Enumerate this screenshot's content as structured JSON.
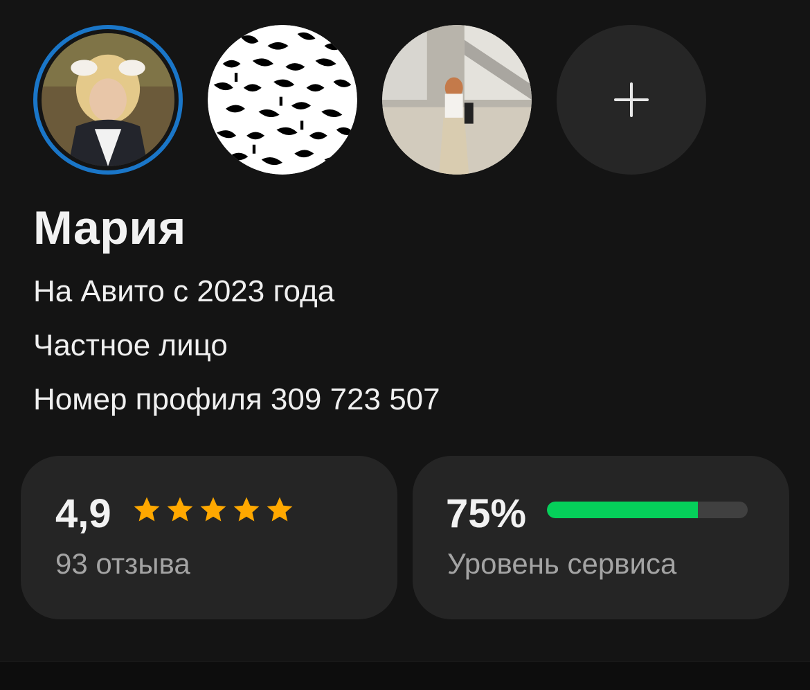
{
  "profile": {
    "name": "Мария",
    "since": "На Авито с 2023 года",
    "type": "Частное лицо",
    "profile_number": "Номер профиля 309 723 507"
  },
  "stories": [
    {
      "label": "story-photo-1",
      "active": true
    },
    {
      "label": "story-pattern-2",
      "active": false
    },
    {
      "label": "story-photo-3",
      "active": false
    }
  ],
  "rating": {
    "value": "4,9",
    "stars": 5,
    "reviews": "93 отзыва",
    "star_color": "#ffa800"
  },
  "service": {
    "value": "75%",
    "level": 0.75,
    "label": "Уровень сервиса",
    "bar_color": "#05d05a"
  },
  "colors": {
    "background": "#141414",
    "card": "#252525",
    "active_ring": "#1a76c8"
  },
  "icons": {
    "add_story": "plus-icon",
    "star": "star-icon"
  }
}
